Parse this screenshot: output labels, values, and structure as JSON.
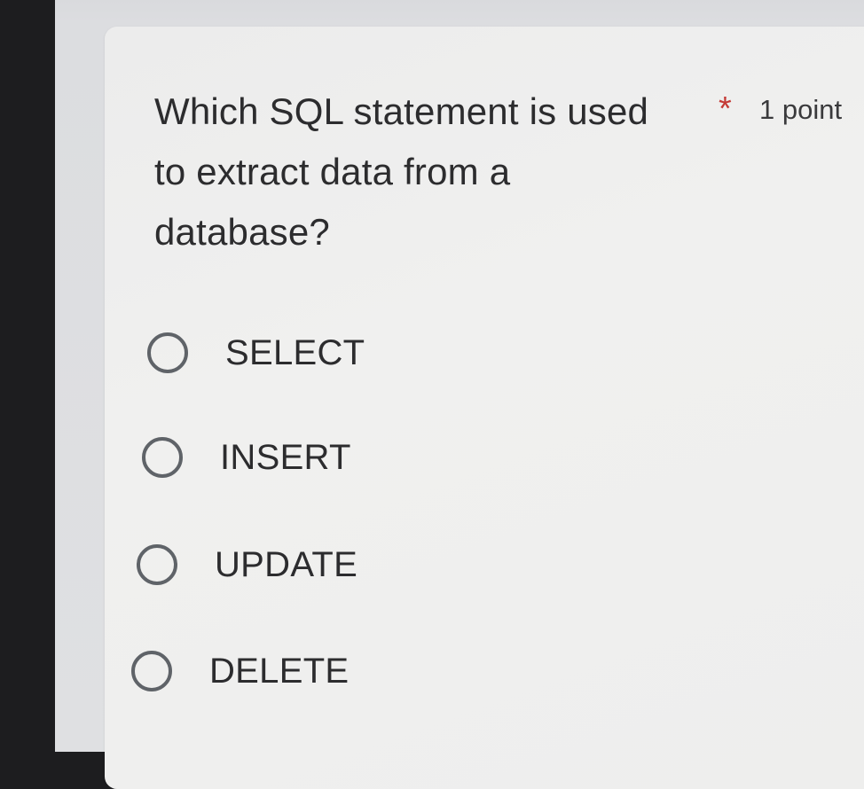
{
  "question": {
    "lines": [
      "Which SQL statement is used",
      "to extract data from a",
      "database?"
    ],
    "required_marker": "*",
    "points": "1 point"
  },
  "options": [
    {
      "label": "SELECT",
      "selected": false
    },
    {
      "label": "INSERT",
      "selected": false
    },
    {
      "label": "UPDATE",
      "selected": false
    },
    {
      "label": "DELETE",
      "selected": false
    }
  ],
  "colors": {
    "required_star": "#c43a35",
    "text": "#2c2c2e",
    "radio_border": "#5f6368",
    "card_background": "#eeeeed"
  }
}
